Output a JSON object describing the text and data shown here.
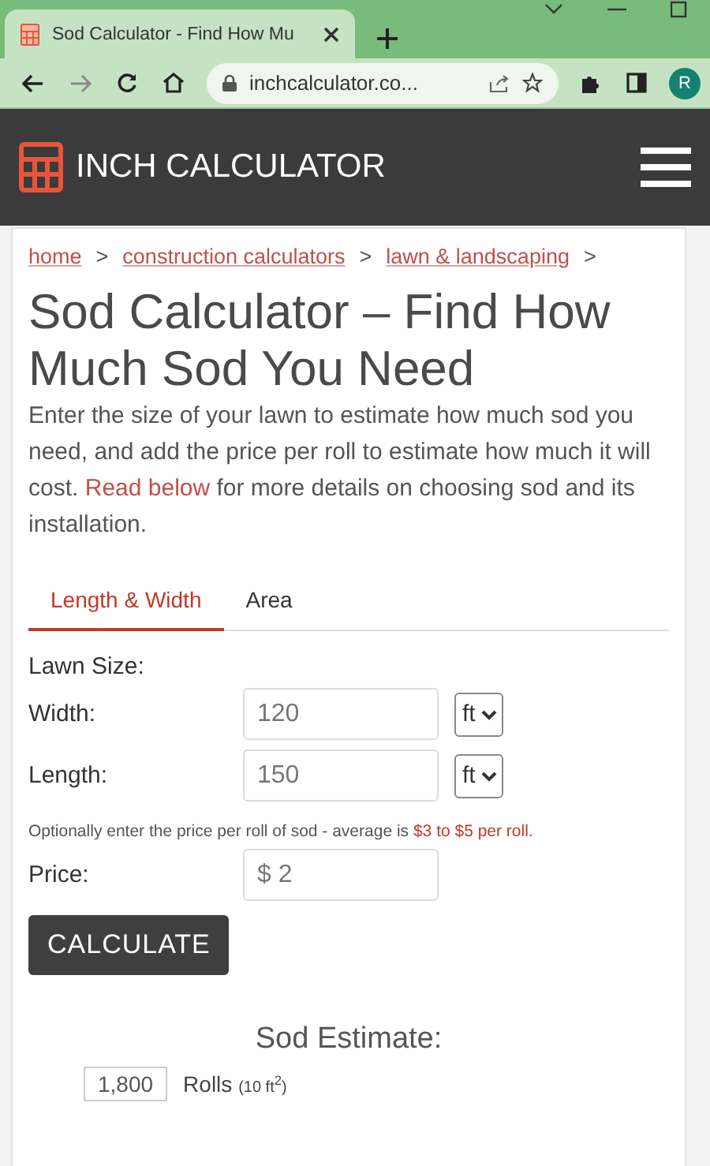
{
  "browser": {
    "tab_title": "Sod Calculator - Find How Mu",
    "url": "inchcalculator.co...",
    "profile_initial": "R"
  },
  "site": {
    "name": "INCH CALCULATOR"
  },
  "breadcrumb": {
    "separator": ">",
    "items": [
      "home",
      "construction calculators",
      "lawn & landscaping"
    ]
  },
  "title": "Sod Calculator – Find How Much Sod You Need",
  "intro": {
    "before": "Enter the size of your lawn to estimate how much sod you need, and add the price per roll to estimate how much it will cost. ",
    "link": "Read below",
    "after": " for more details on choosing sod and its installation."
  },
  "tabs": [
    {
      "label": "Length & Width",
      "selected": true
    },
    {
      "label": "Area",
      "selected": false
    }
  ],
  "form": {
    "section_label": "Lawn Size:",
    "fields": [
      {
        "label": "Width:",
        "value": "120",
        "unit": "ft"
      },
      {
        "label": "Length:",
        "value": "150",
        "unit": "ft"
      }
    ],
    "price_note": {
      "text": "Optionally enter the price per roll of sod - average is ",
      "highlight": "$3 to $5 per roll."
    },
    "price": {
      "label": "Price:",
      "prefix": "$",
      "value": "2"
    },
    "button": "CALCULATE"
  },
  "estimate": {
    "heading": "Sod Estimate:",
    "results": [
      {
        "value": "1,800",
        "unit": "Rolls",
        "note": "(10 ft$^{2}$)"
      }
    ]
  }
}
